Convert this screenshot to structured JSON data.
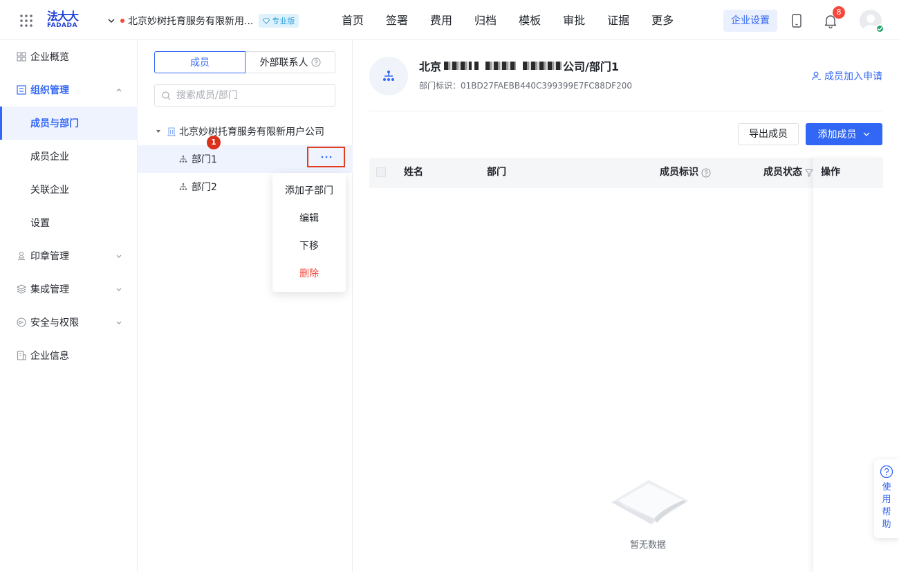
{
  "header": {
    "logo_main": "法大大",
    "logo_sub": "FADADA",
    "org_name": "北京妙树托育服务有限新用...",
    "edition_badge": "专业版",
    "nav": [
      "首页",
      "签署",
      "费用",
      "归档",
      "模板",
      "审批",
      "证据",
      "更多"
    ],
    "enterprise_settings": "企业设置",
    "notification_count": "8"
  },
  "sidebar": {
    "items": [
      {
        "label": "企业概览",
        "icon": "overview-icon"
      },
      {
        "label": "组织管理",
        "icon": "org-icon",
        "expanded": true
      },
      {
        "label": "成员与部门",
        "active": true
      },
      {
        "label": "成员企业"
      },
      {
        "label": "关联企业"
      },
      {
        "label": "设置"
      },
      {
        "label": "印章管理",
        "icon": "seal-icon"
      },
      {
        "label": "集成管理",
        "icon": "integration-icon"
      },
      {
        "label": "安全与权限",
        "icon": "security-icon"
      },
      {
        "label": "企业信息",
        "icon": "info-icon"
      }
    ]
  },
  "panel": {
    "tab_members": "成员",
    "tab_external": "外部联系人",
    "search_placeholder": "搜索成员/部门",
    "root_name": "北京妙树托育服务有限新用户公司",
    "departments": [
      "部门1",
      "部门2"
    ],
    "step_number": "1",
    "menu": [
      "添加子部门",
      "编辑",
      "下移",
      "删除"
    ]
  },
  "detail": {
    "title_prefix": "北京",
    "title_suffix": "公司/部门1",
    "dept_id": "部门标识：01BD27FAEBB440C399399E7FC88DF200",
    "join_request": "成员加入申请",
    "export_button": "导出成员",
    "add_button": "添加成员",
    "columns": [
      "姓名",
      "部门",
      "成员标识",
      "成员状态",
      "操作"
    ],
    "empty_text": "暂无数据"
  },
  "help": {
    "label": "使用帮助"
  },
  "colors": {
    "primary": "#3267f5",
    "danger": "#f5483b",
    "highlight": "#e13d22"
  }
}
